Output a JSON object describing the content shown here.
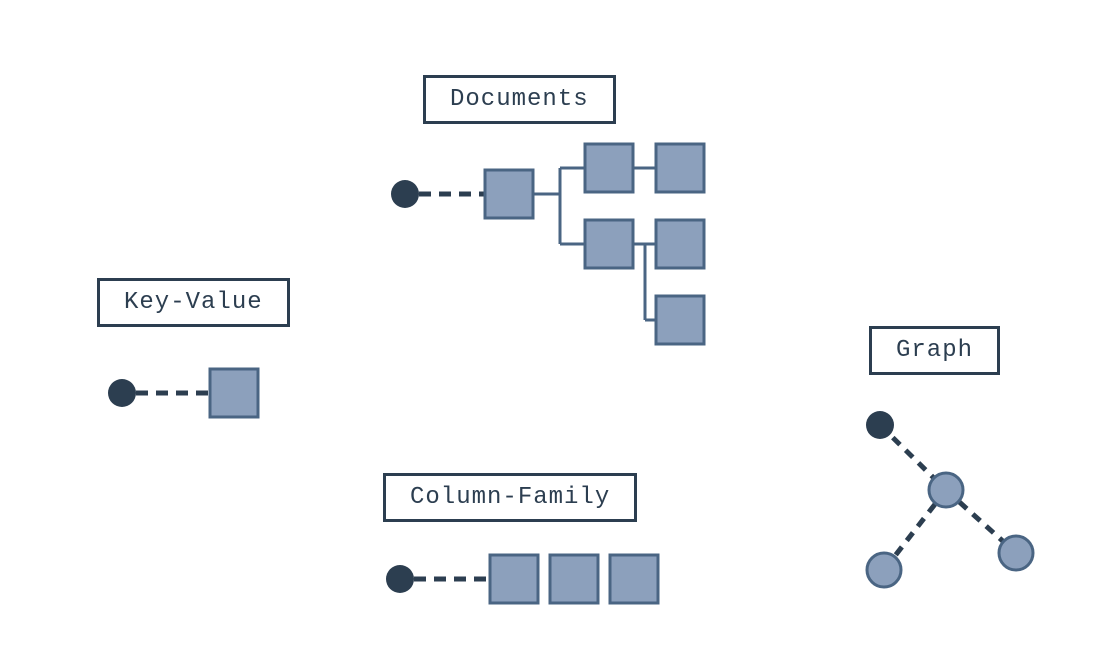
{
  "sections": {
    "keyValue": {
      "label": "Key-Value"
    },
    "documents": {
      "label": "Documents"
    },
    "columnFamily": {
      "label": "Column-Family"
    },
    "graph": {
      "label": "Graph"
    }
  },
  "colors": {
    "darkNavy": "#2c3e50",
    "lightBlue": "#8ca0bc",
    "borderBlue": "#4a6583"
  }
}
